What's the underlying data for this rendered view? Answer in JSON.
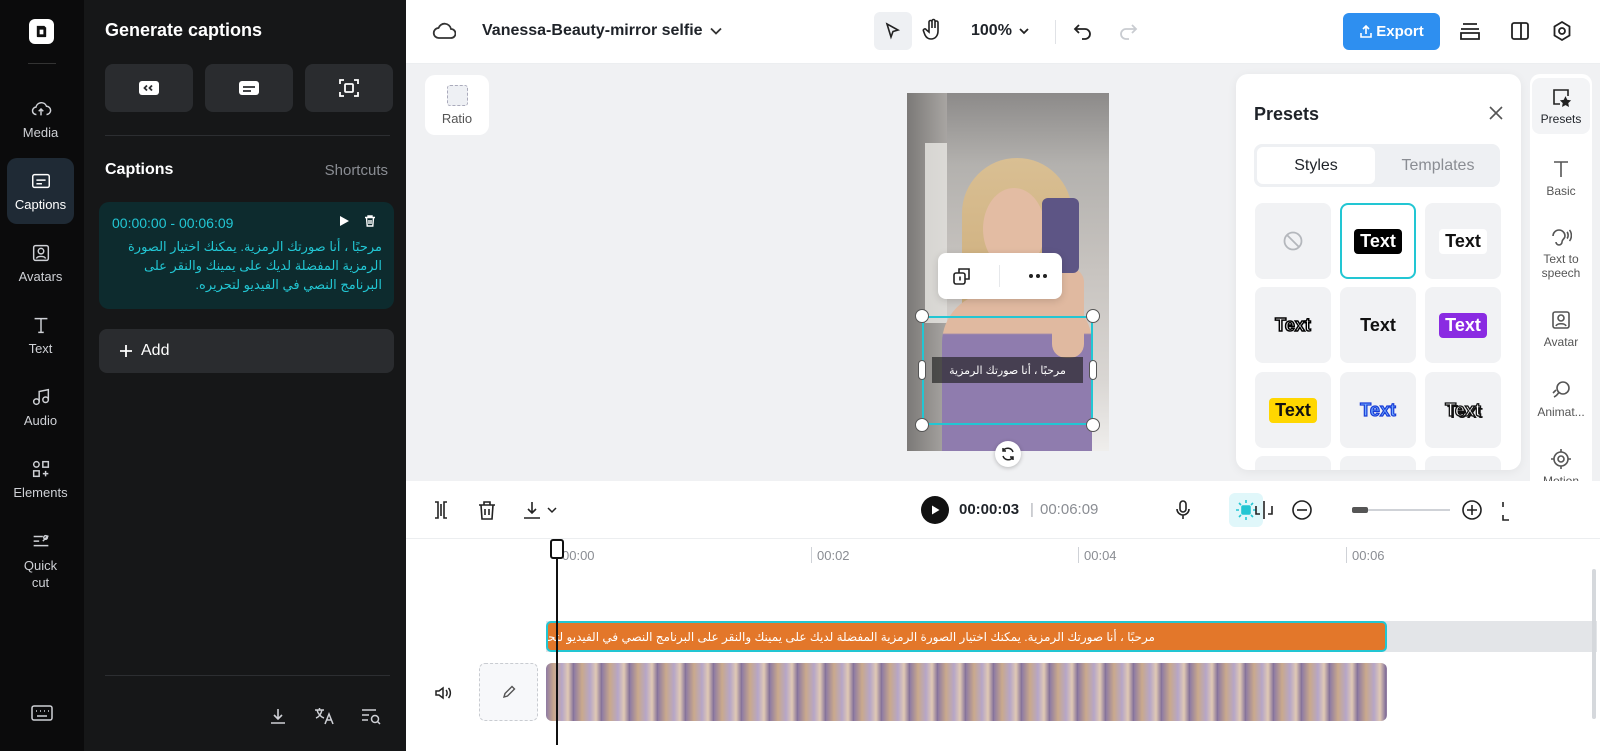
{
  "rail": {
    "items": [
      {
        "label": "Media",
        "icon": "cloud-upload-icon"
      },
      {
        "label": "Captions",
        "icon": "captions-icon",
        "active": true
      },
      {
        "label": "Avatars",
        "icon": "avatar-icon"
      },
      {
        "label": "Text",
        "icon": "text-icon"
      },
      {
        "label": "Audio",
        "icon": "music-icon"
      },
      {
        "label": "Elements",
        "icon": "elements-icon"
      },
      {
        "label": "Quick cut",
        "icon": "quick-cut-icon"
      }
    ]
  },
  "panel": {
    "title": "Generate captions",
    "captions_label": "Captions",
    "shortcuts_label": "Shortcuts",
    "caption": {
      "time": "00:00:00 - 00:06:09",
      "text": "مرحبًا ، أنا صورتك الرمزية. يمكنك اختيار الصورة الرمزية المفضلة لديك على يمينك والنقر على البرنامج النصي في الفيديو لتحريره."
    },
    "add_label": "Add"
  },
  "topbar": {
    "project_name": "Vanessa-Beauty-mirror selfie",
    "zoom": "100%",
    "export_label": "Export"
  },
  "canvas": {
    "ratio_label": "Ratio",
    "overlay_caption": "مرحبًا ، أنا صورتك الرمزية"
  },
  "presets": {
    "title": "Presets",
    "tabs": [
      "Styles",
      "Templates"
    ],
    "tile_text": "Text"
  },
  "tools": [
    {
      "label": "Presets",
      "icon": "presets-icon"
    },
    {
      "label": "Basic",
      "icon": "text-basic-icon"
    },
    {
      "label": "Text to speech",
      "icon": "text-to-speech-icon"
    },
    {
      "label": "Avatar",
      "icon": "avatar-icon"
    },
    {
      "label": "Animat...",
      "icon": "animation-icon"
    },
    {
      "label": "Motion tracking",
      "icon": "motion-tracking-icon"
    }
  ],
  "timeline": {
    "current_time": "00:00:03",
    "separator": "|",
    "total_time": "00:06:09",
    "ruler": [
      "00:00",
      "00:02",
      "00:04",
      "00:06"
    ],
    "caption_clip_text": "مرحبًا ، أنا صورتك الرمزية. يمكنك اختيار الصورة الرمزية المفضلة لديك على يمينك والنقر على البرنامج النصي في الفيديو لتحريره."
  },
  "colors": {
    "accent": "#22c6d3",
    "export": "#2e8ff0",
    "caption_clip": "#e3772a"
  }
}
